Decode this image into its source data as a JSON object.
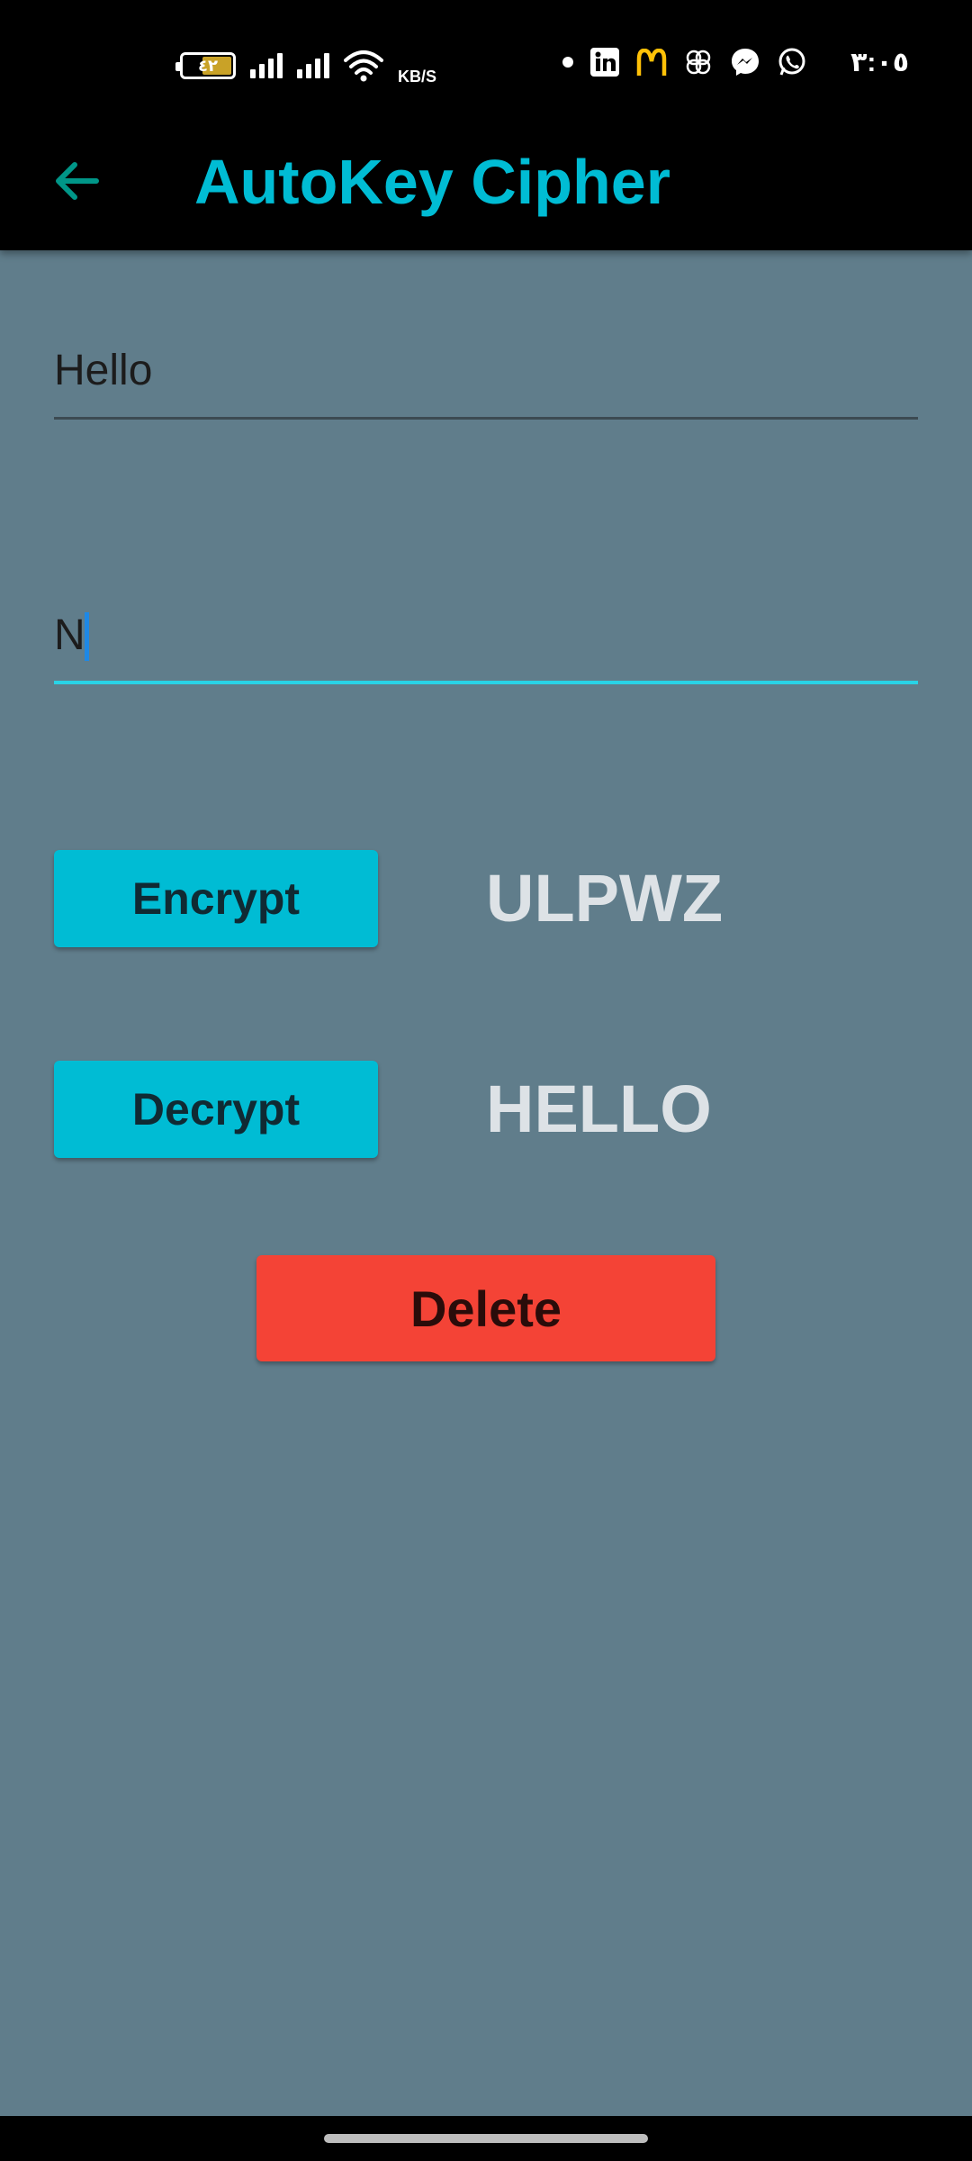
{
  "status_bar": {
    "battery_level": "٤٢",
    "network_speed_unit": "KB/S",
    "time": "٣:٠٥",
    "notification_icons": [
      "linkedin-icon",
      "mcdonalds-icon",
      "clover-icon",
      "messenger-icon",
      "whatsapp-icon"
    ]
  },
  "app_bar": {
    "title": "AutoKey Cipher",
    "back_icon": "arrow-left-icon",
    "title_color": "#00bcd4"
  },
  "inputs": {
    "plaintext_value": "Hello",
    "key_value": "N"
  },
  "actions": {
    "encrypt_label": "Encrypt",
    "encrypt_result": "ULPWZ",
    "decrypt_label": "Decrypt",
    "decrypt_result": "HELLO",
    "delete_label": "Delete"
  },
  "colors": {
    "background": "#607d8b",
    "accent": "#00bcd4",
    "delete": "#f44336",
    "focused_underline": "#29d3e6"
  }
}
